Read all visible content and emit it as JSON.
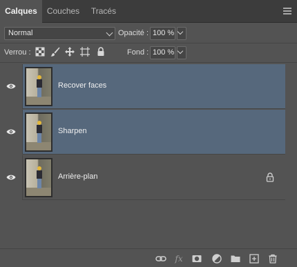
{
  "tabs": [
    {
      "label": "Calques",
      "active": true
    },
    {
      "label": "Couches",
      "active": false
    },
    {
      "label": "Tracés",
      "active": false
    }
  ],
  "blend_mode": {
    "value": "Normal"
  },
  "opacity": {
    "label": "Opacité :",
    "value": "100 %"
  },
  "lock": {
    "label": "Verrou :",
    "icons": [
      "transparency-lock-icon",
      "brush-lock-icon",
      "move-lock-icon",
      "artboard-lock-icon",
      "padlock-icon"
    ]
  },
  "fill": {
    "label": "Fond :",
    "value": "100 %"
  },
  "layers": [
    {
      "name": "Recover faces",
      "selected": true,
      "visible": true,
      "locked": false
    },
    {
      "name": "Sharpen",
      "selected": true,
      "visible": true,
      "locked": false
    },
    {
      "name": "Arrière-plan",
      "selected": false,
      "visible": true,
      "locked": true
    }
  ],
  "footer_icons": [
    "link-icon",
    "fx-icon",
    "mask-icon",
    "adjustment-icon",
    "folder-icon",
    "new-layer-icon",
    "trash-icon"
  ],
  "colors": {
    "panel_bg": "#535353",
    "selected_layer": "#56687c",
    "tab_bar": "#3c3c3c"
  }
}
